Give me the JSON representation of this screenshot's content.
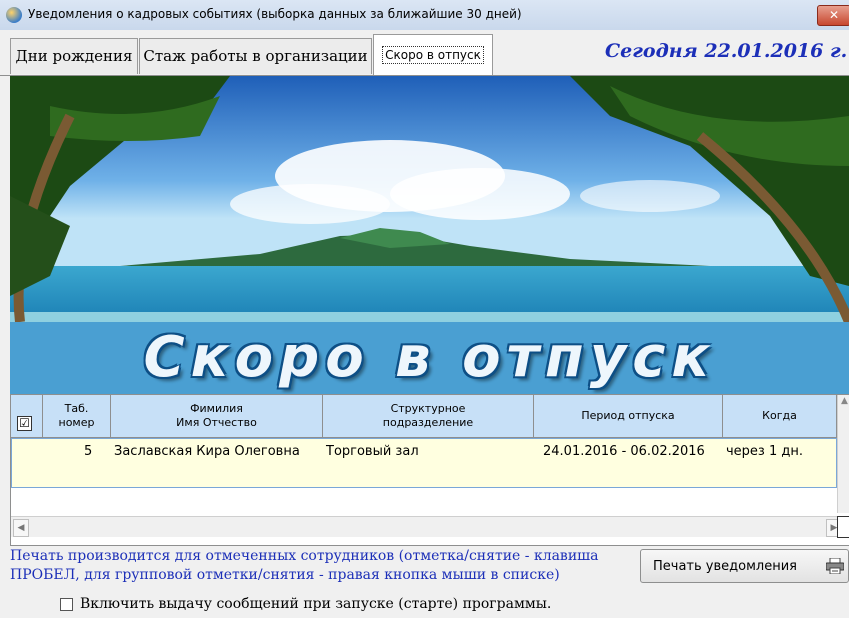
{
  "window": {
    "title": "Уведомления о кадровых событиях (выборка данных за ближайшие 30 дней)",
    "close_glyph": "✕"
  },
  "tabs": [
    {
      "label": "Дни рождения"
    },
    {
      "label": "Стаж работы в организации"
    },
    {
      "label": "Скоро в отпуск",
      "active": true
    }
  ],
  "today": "Сегодня 22.01.2016 г.",
  "banner": {
    "heading": "Скоро в отпуск"
  },
  "grid": {
    "header_check": "☑",
    "columns": [
      "Таб.\nномер",
      "Фимилия\nИмя Отчество",
      "Структурное\nподразделение",
      "Период отпуска",
      "Когда"
    ],
    "rows": [
      {
        "tab_no": "5",
        "name": "Заславская Кира Олеговна",
        "department": "Торговый зал",
        "period": "24.01.2016 - 06.02.2016",
        "when": "через 1 дн."
      }
    ]
  },
  "footer": {
    "note_line1": "Печать производится для отмеченных сотрудников (отметка/снятие - клавиша",
    "note_line2": "ПРОБЕЛ, для групповой отметки/снятия - правая кнопка мыши в списке)",
    "print_button": "Печать уведомления",
    "startup_checkbox": "Включить выдачу сообщений при запуске (старте) программы.",
    "startup_checked": false
  },
  "colors": {
    "accent": "#1c2fb8",
    "grid_header": "#c7e0f7",
    "row_highlight": "#ffffe0",
    "banner_band": "#4a9fd2"
  },
  "icons": [
    "app-icon",
    "close-icon",
    "printer-icon",
    "checkbox-icon",
    "scroll-arrow-icon"
  ]
}
